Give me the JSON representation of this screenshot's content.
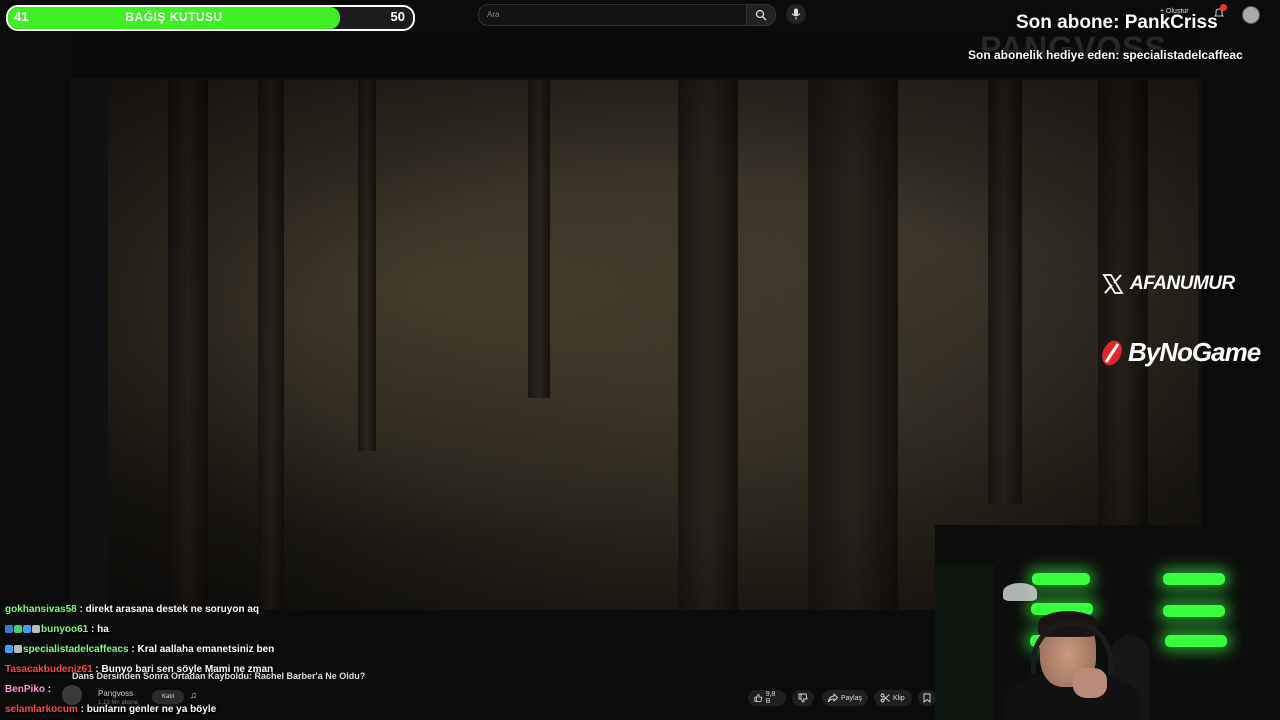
{
  "donation_bar": {
    "current": "41",
    "title": "BAĞIŞ KUTUSU",
    "goal": "50",
    "progress": 0.82,
    "color": "#3fee25"
  },
  "youtube_header": {
    "search_placeholder": "Ara",
    "create_label": "Oluştur",
    "notification_count": "1"
  },
  "stream_overlay": {
    "last_sub": "Son abone: PankCriss",
    "channel_watermark": "PANGVOSS",
    "gift_sub": "Son abonelik hediye eden: specialistadelcaffeac",
    "x_handle": "AFANUMUR",
    "sponsor": "ByNoGame",
    "accent": "#36ff3e"
  },
  "chat": [
    {
      "user": "gokhansivas58",
      "user_color": "#7dff7d",
      "message": "direkt arasana destek ne soruyon aq",
      "badges": []
    },
    {
      "user": "bunyoo61",
      "user_color": "#7dff7d",
      "message": "ha",
      "badges": [
        "#3a7bd5",
        "#3fd06c",
        "#3aa0ff",
        "#bbbbbb"
      ]
    },
    {
      "user": "specialistadelcaffeacs",
      "user_color": "#7dff7d",
      "message": "Kral aallaha emanetsiniz ben",
      "badges": [
        "#3aa0ff",
        "#bbbbbb"
      ]
    },
    {
      "user": "Tasacakbudeniz61",
      "user_color": "#ff4a4a",
      "message": "Bunyo bari sen söyle Mami ne zman",
      "badges": []
    },
    {
      "user": "BenPiko",
      "user_color": "#ff9bd2",
      "message": "",
      "badges": []
    },
    {
      "user": "selamlarkocum",
      "user_color": "#ff4a4a",
      "message": "bunların genler ne ya böyle",
      "badges": []
    }
  ],
  "video_info": {
    "title": "Dans Dersinden Sonra Ortadan Kayboldu: Rachel Barber'a Ne Oldu?",
    "uploader": "Pangvoss",
    "subs": "1,13 Mn abone",
    "join_label": "Katıl",
    "likes": "9,8 B",
    "share_label": "Paylaş",
    "clip_label": "Klip"
  }
}
